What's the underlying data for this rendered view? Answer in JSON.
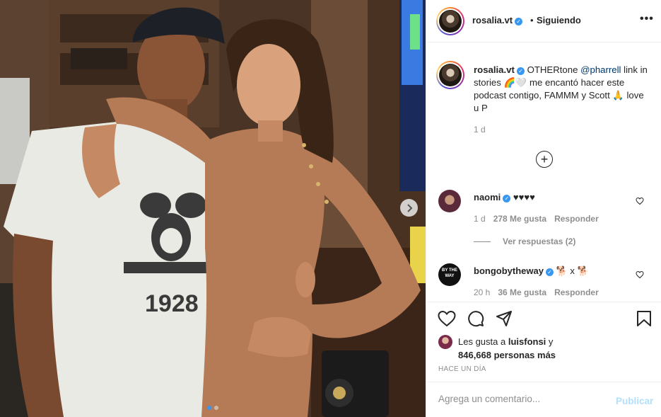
{
  "header": {
    "username": "rosalia.vt",
    "separator": "•",
    "follow_status": "Siguiendo",
    "more_label": "•••"
  },
  "caption": {
    "username": "rosalia.vt",
    "text_before": "OTHERtone",
    "mention": "@pharrell",
    "text_after": "link in stories 🌈🤍 me encantó hacer este podcast contigo, FAMMM y Scott 🙏 love u P",
    "time": "1 d"
  },
  "comments": [
    {
      "username": "naomi",
      "text": "♥♥♥♥",
      "time": "1 d",
      "likes": "278 Me gusta",
      "reply": "Responder",
      "view_replies": "Ver respuestas (2)"
    },
    {
      "username": "bongobytheway",
      "text": "🐕 x 🐕",
      "time": "20 h",
      "likes": "36 Me gusta",
      "reply": "Responder",
      "avatar_text": "BY THE WAY"
    }
  ],
  "likes": {
    "prefix": "Les gusta a",
    "user": "luisfonsi",
    "conjunction": "y",
    "count": "846,668 personas más"
  },
  "posted": "HACE UN DÍA",
  "add_comment": {
    "placeholder": "Agrega un comentario...",
    "publish_label": "Publicar"
  },
  "carousel": {
    "slides": 2,
    "current": 1
  },
  "photo": {
    "shirt_text": "1928"
  },
  "colors": {
    "verified": "#3897f0",
    "mention": "#00376b",
    "publish_disabled": "#b2dffc",
    "secondary_text": "#8e8e8e"
  }
}
